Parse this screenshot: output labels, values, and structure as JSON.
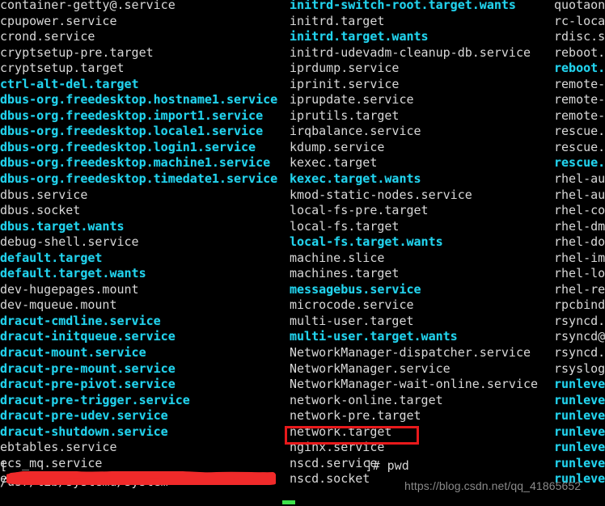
{
  "terminal": {
    "shell_prompt_prefix": "[",
    "shell_prompt_suffix": "]# ",
    "command": "pwd",
    "command_output": "/usr/lib/systemd/system",
    "working_directory": "/usr/lib/systemd/system",
    "redaction_note": "prompt user@host path redacted with red scribble"
  },
  "watermark": {
    "text": "https://blog.csdn.net/qq_41865652"
  },
  "annotation": {
    "highlighted_entry": "nginx.service",
    "box_color": "#e8191b",
    "redaction_color": "#f02a2a"
  },
  "colors": {
    "background": "#000000",
    "file_text": "#d8d8d8",
    "dir_text": "#22d3ee",
    "cursor": "#3de04a"
  },
  "listing": {
    "columns": [
      {
        "name": "column-1",
        "entries": [
          {
            "text": "container-getty@.service",
            "type": "file"
          },
          {
            "text": "cpupower.service",
            "type": "file"
          },
          {
            "text": "crond.service",
            "type": "file"
          },
          {
            "text": "cryptsetup-pre.target",
            "type": "file"
          },
          {
            "text": "cryptsetup.target",
            "type": "file"
          },
          {
            "text": "ctrl-alt-del.target",
            "type": "dir"
          },
          {
            "text": "dbus-org.freedesktop.hostname1.service",
            "type": "dir"
          },
          {
            "text": "dbus-org.freedesktop.import1.service",
            "type": "dir"
          },
          {
            "text": "dbus-org.freedesktop.locale1.service",
            "type": "dir"
          },
          {
            "text": "dbus-org.freedesktop.login1.service",
            "type": "dir"
          },
          {
            "text": "dbus-org.freedesktop.machine1.service",
            "type": "dir"
          },
          {
            "text": "dbus-org.freedesktop.timedate1.service",
            "type": "dir"
          },
          {
            "text": "dbus.service",
            "type": "file"
          },
          {
            "text": "dbus.socket",
            "type": "file"
          },
          {
            "text": "dbus.target.wants",
            "type": "dir"
          },
          {
            "text": "debug-shell.service",
            "type": "file"
          },
          {
            "text": "default.target",
            "type": "dir"
          },
          {
            "text": "default.target.wants",
            "type": "dir"
          },
          {
            "text": "dev-hugepages.mount",
            "type": "file"
          },
          {
            "text": "dev-mqueue.mount",
            "type": "file"
          },
          {
            "text": "dracut-cmdline.service",
            "type": "dir"
          },
          {
            "text": "dracut-initqueue.service",
            "type": "dir"
          },
          {
            "text": "dracut-mount.service",
            "type": "dir"
          },
          {
            "text": "dracut-pre-mount.service",
            "type": "dir"
          },
          {
            "text": "dracut-pre-pivot.service",
            "type": "dir"
          },
          {
            "text": "dracut-pre-trigger.service",
            "type": "dir"
          },
          {
            "text": "dracut-pre-udev.service",
            "type": "dir"
          },
          {
            "text": "dracut-shutdown.service",
            "type": "dir"
          },
          {
            "text": "ebtables.service",
            "type": "file"
          },
          {
            "text": "ecs_mq.service",
            "type": "file"
          },
          {
            "text": "emergency.service",
            "type": "file"
          }
        ]
      },
      {
        "name": "column-2",
        "entries": [
          {
            "text": "initrd-switch-root.target.wants",
            "type": "dir"
          },
          {
            "text": "initrd.target",
            "type": "file"
          },
          {
            "text": "initrd.target.wants",
            "type": "dir"
          },
          {
            "text": "initrd-udevadm-cleanup-db.service",
            "type": "file"
          },
          {
            "text": "iprdump.service",
            "type": "file"
          },
          {
            "text": "iprinit.service",
            "type": "file"
          },
          {
            "text": "iprupdate.service",
            "type": "file"
          },
          {
            "text": "iprutils.target",
            "type": "file"
          },
          {
            "text": "irqbalance.service",
            "type": "file"
          },
          {
            "text": "kdump.service",
            "type": "file"
          },
          {
            "text": "kexec.target",
            "type": "file"
          },
          {
            "text": "kexec.target.wants",
            "type": "dir"
          },
          {
            "text": "kmod-static-nodes.service",
            "type": "file"
          },
          {
            "text": "local-fs-pre.target",
            "type": "file"
          },
          {
            "text": "local-fs.target",
            "type": "file"
          },
          {
            "text": "local-fs.target.wants",
            "type": "dir"
          },
          {
            "text": "machine.slice",
            "type": "file"
          },
          {
            "text": "machines.target",
            "type": "file"
          },
          {
            "text": "messagebus.service",
            "type": "dir"
          },
          {
            "text": "microcode.service",
            "type": "file"
          },
          {
            "text": "multi-user.target",
            "type": "file"
          },
          {
            "text": "multi-user.target.wants",
            "type": "dir"
          },
          {
            "text": "NetworkManager-dispatcher.service",
            "type": "file"
          },
          {
            "text": "NetworkManager.service",
            "type": "file"
          },
          {
            "text": "NetworkManager-wait-online.service",
            "type": "file"
          },
          {
            "text": "network-online.target",
            "type": "file"
          },
          {
            "text": "network-pre.target",
            "type": "file"
          },
          {
            "text": "network.target",
            "type": "file"
          },
          {
            "text": "nginx.service",
            "type": "file"
          },
          {
            "text": "nscd.service",
            "type": "file"
          },
          {
            "text": "nscd.socket",
            "type": "file"
          }
        ]
      },
      {
        "name": "column-3",
        "entries": [
          {
            "text": "quotaon",
            "type": "file"
          },
          {
            "text": "rc-local",
            "type": "file"
          },
          {
            "text": "rdisc.se",
            "type": "file"
          },
          {
            "text": "reboot.",
            "type": "file"
          },
          {
            "text": "reboot.",
            "type": "dir"
          },
          {
            "text": "remote-",
            "type": "file"
          },
          {
            "text": "remote-",
            "type": "file"
          },
          {
            "text": "remote-",
            "type": "file"
          },
          {
            "text": "rescue.s",
            "type": "file"
          },
          {
            "text": "rescue.",
            "type": "file"
          },
          {
            "text": "rescue.",
            "type": "dir"
          },
          {
            "text": "rhel-au",
            "type": "file"
          },
          {
            "text": "rhel-au",
            "type": "file"
          },
          {
            "text": "rhel-co",
            "type": "file"
          },
          {
            "text": "rhel-dm",
            "type": "file"
          },
          {
            "text": "rhel-do",
            "type": "file"
          },
          {
            "text": "rhel-im",
            "type": "file"
          },
          {
            "text": "rhel-lo",
            "type": "file"
          },
          {
            "text": "rhel-re",
            "type": "file"
          },
          {
            "text": "rpcbind",
            "type": "file"
          },
          {
            "text": "rsyncd.",
            "type": "file"
          },
          {
            "text": "rsyncd@",
            "type": "file"
          },
          {
            "text": "rsyncd.",
            "type": "file"
          },
          {
            "text": "rsyslog",
            "type": "file"
          },
          {
            "text": "runleve",
            "type": "dir"
          },
          {
            "text": "runleve",
            "type": "dir"
          },
          {
            "text": "runleve",
            "type": "dir"
          },
          {
            "text": "runleve",
            "type": "dir"
          },
          {
            "text": "runleve",
            "type": "dir"
          },
          {
            "text": "runleve",
            "type": "dir"
          },
          {
            "text": "runleve",
            "type": "dir"
          }
        ]
      }
    ]
  }
}
